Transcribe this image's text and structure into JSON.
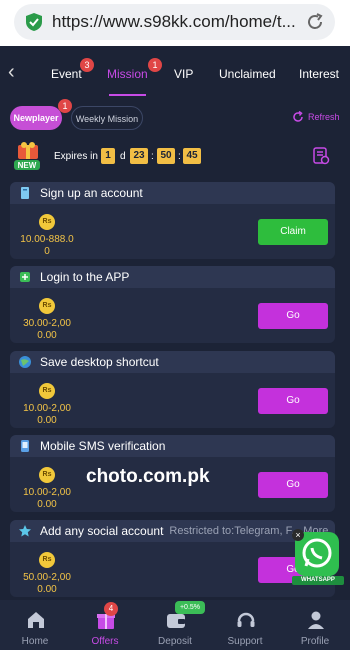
{
  "browser": {
    "url": "https://www.s98kk.com/home/t..."
  },
  "tabs": [
    {
      "label": "Event",
      "badge": "3"
    },
    {
      "label": "Mission",
      "badge": "1",
      "active": true
    },
    {
      "label": "VIP"
    },
    {
      "label": "Unclaimed"
    },
    {
      "label": "Interest"
    }
  ],
  "mission_types": {
    "newplayer": "Newplayer",
    "newplayer_badge": "1",
    "weekly": "Weekly Mission",
    "refresh": "Refresh"
  },
  "countdown": {
    "label": "Expires in",
    "days": "1",
    "day_unit": "d",
    "hours": "23",
    "minutes": "50",
    "seconds": "45",
    "badge_text": "NEW"
  },
  "missions": [
    {
      "title": "Sign up an account",
      "currency": "Rs",
      "reward": "10.00-888.0\n0",
      "action": "Claim"
    },
    {
      "title": "Login to the APP",
      "currency": "Rs",
      "reward": "30.00-2,00\n0.00",
      "action": "Go"
    },
    {
      "title": "Save desktop shortcut",
      "currency": "Rs",
      "reward": "10.00-2,00\n0.00",
      "action": "Go"
    },
    {
      "title": "Mobile SMS verification",
      "currency": "Rs",
      "reward": "10.00-2,00\n0.00",
      "action": "Go"
    },
    {
      "title": "Add any social account",
      "restriction": "Restricted to:Telegram, F... More",
      "currency": "Rs",
      "reward": "50.00-2,00\n0.00",
      "action": "Go"
    }
  ],
  "watermark": "choto.com.pk",
  "whatsapp": {
    "label": "WHATSAPP",
    "close": "×"
  },
  "bottom_nav": [
    {
      "label": "Home"
    },
    {
      "label": "Offers",
      "badge": "4",
      "active": true
    },
    {
      "label": "Deposit",
      "badge": "+0.5%"
    },
    {
      "label": "Support"
    },
    {
      "label": "Profile"
    }
  ],
  "colors": {
    "accent": "#c74be6",
    "claim": "#2ebd3d",
    "go": "#c431dc",
    "gold": "#f2c347",
    "background": "#1c2336"
  }
}
